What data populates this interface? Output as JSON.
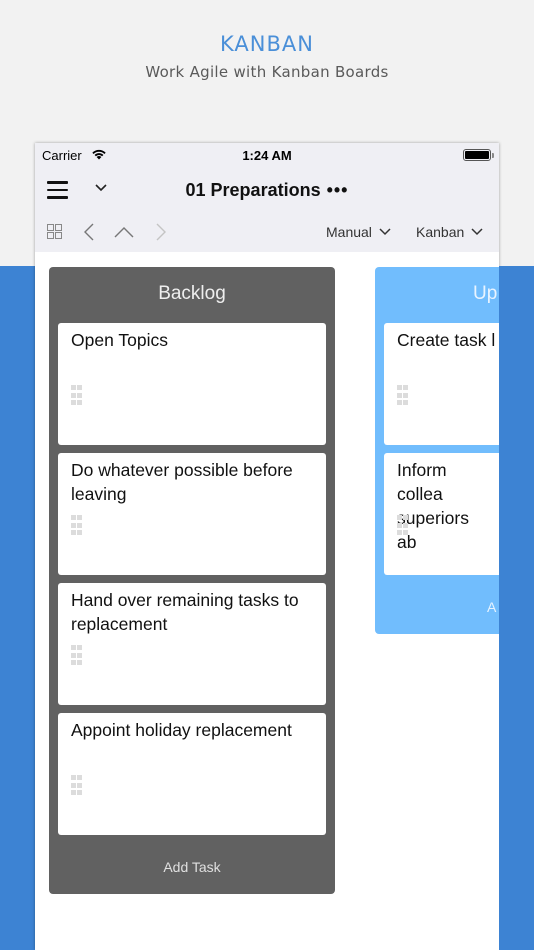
{
  "promo": {
    "title": "KANBAN",
    "subtitle": "Work Agile with Kanban Boards"
  },
  "statusbar": {
    "carrier": "Carrier",
    "time": "1:24 AM",
    "battery_level": 1.0
  },
  "navbar": {
    "title": "01 Preparations",
    "more_label": "•••"
  },
  "toolbar": {
    "sort_dropdown": "Manual",
    "view_dropdown": "Kanban"
  },
  "columns": [
    {
      "title": "Backlog",
      "color": "#616161",
      "cards": [
        {
          "title": "Open Topics"
        },
        {
          "title": "Do whatever possible before leaving"
        },
        {
          "title": "Hand over remaining tasks to replacement"
        },
        {
          "title": "Appoint holiday replacement"
        }
      ],
      "add_label": "Add Task"
    },
    {
      "title": "Up",
      "color": "#71bdfd",
      "cards": [
        {
          "title": "Create task l"
        },
        {
          "title": "Inform collea superiors ab"
        }
      ],
      "add_label": "A"
    }
  ],
  "colors": {
    "accent": "#4a8fd8",
    "band": "#3d83d3",
    "bar_bg": "#efeff4"
  }
}
